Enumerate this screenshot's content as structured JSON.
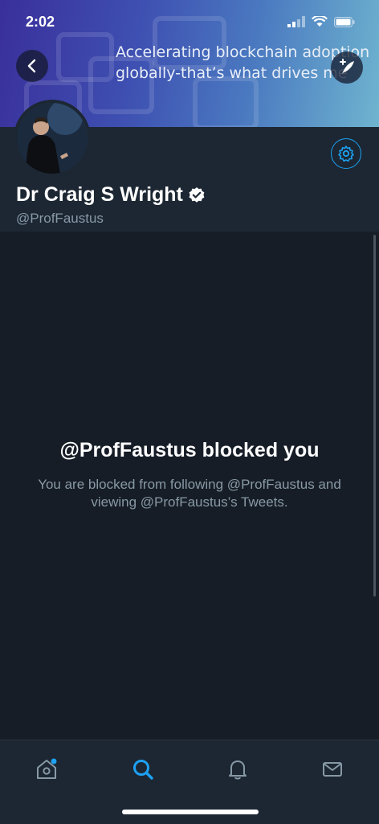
{
  "status_bar": {
    "time": "2:02"
  },
  "banner": {
    "tagline_line1": "Accelerating blockchain adoption",
    "tagline_line2": "globally-that’s what drives me"
  },
  "profile": {
    "display_name": "Dr Craig S Wright",
    "handle": "@ProfFaustus",
    "verified": true
  },
  "blocked_notice": {
    "title": "@ProfFaustus blocked you",
    "message": "You are blocked from following @ProfFaustus and viewing @ProfFaustus’s Tweets."
  },
  "tabs": [
    {
      "icon": "home-icon",
      "active": false,
      "has_notification_dot": true
    },
    {
      "icon": "search-icon",
      "active": true
    },
    {
      "icon": "bell-icon",
      "active": false
    },
    {
      "icon": "mail-icon",
      "active": false
    }
  ],
  "colors": {
    "accent": "#1da1f2",
    "background": "#161d26",
    "header": "#1c2733",
    "muted_text": "#8899a6"
  }
}
